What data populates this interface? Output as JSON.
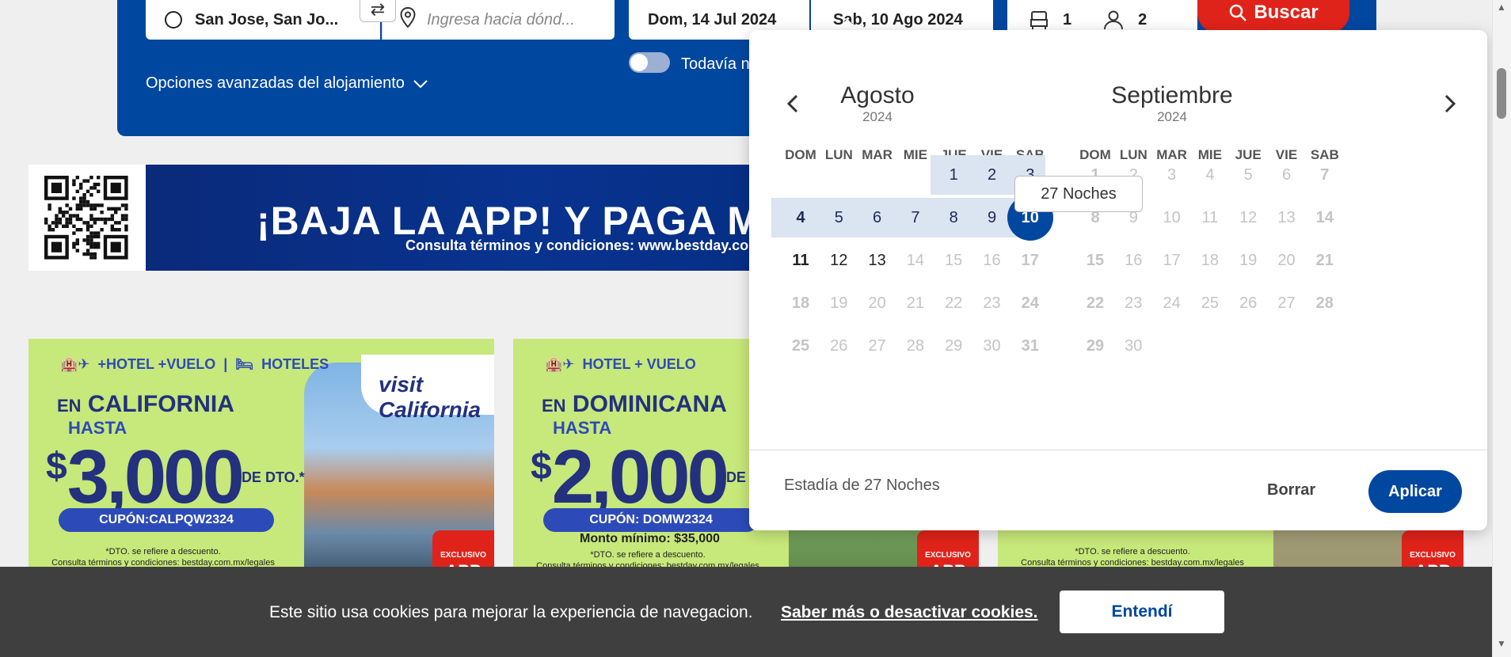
{
  "search": {
    "origin": "San Jose, San Jo...",
    "destination_placeholder": "Ingresa hacia dónd...",
    "checkin": "Dom, 14 Jul 2024",
    "checkout": "Sab, 10 Ago 2024",
    "rooms": "1",
    "adults": "2",
    "search_label": "Buscar",
    "advanced_options": "Opciones avanzadas del alojamiento",
    "toggle_label": "Todavía n"
  },
  "banner": {
    "headline": "¡BAJA LA APP! Y PAGA ME",
    "terms": "Consulta términos y condiciones: www.bestday.com"
  },
  "cards": [
    {
      "header": "HOTEL + VUELO | HOTELES",
      "header_a": "+HOTEL +VUELO",
      "header_b": "HOTELES",
      "prefix": "EN",
      "destination": "CALIFORNIA",
      "upto": "HASTA",
      "currency": "$",
      "amount": "3,000",
      "suffix": "DE DTO.*",
      "coupon": "CUPÓN:CALPQW2324",
      "minimum": "",
      "fine1": "*DTO. se refiere a descuento.",
      "fine2": "Consulta términos y condiciones: bestday.com.mx/legales",
      "logo": "visit California",
      "exclusive": "EXCLUSIVO",
      "app": "APP"
    },
    {
      "header_a": "HOTEL + VUELO",
      "header_b": "",
      "prefix": "EN",
      "destination": "DOMINICANA",
      "upto": "HASTA",
      "currency": "$",
      "amount": "2,000",
      "suffix": "DE DTO.",
      "coupon": "CUPÓN: DOMW2324",
      "minimum": "Monto mínimo: $35,000",
      "fine1": "*DTO. se refiere a descuento.",
      "fine2": "Consulta términos y condiciones: bestday.com.mx/legales",
      "exclusive": "EXCLUSIVO",
      "app": "APP"
    },
    {
      "fine1": "*DTO. se refiere a descuento.",
      "fine2": "Consulta términos y condiciones: bestday.com.mx/legales",
      "exclusive": "EXCLUSIVO",
      "app": "APP"
    }
  ],
  "datepicker": {
    "weekdays": [
      "DOM",
      "LUN",
      "MAR",
      "MIE",
      "JUE",
      "VIE",
      "SAB"
    ],
    "months": [
      {
        "name": "Agosto",
        "year": "2024",
        "first_weekday": 4,
        "days": 31
      },
      {
        "name": "Septiembre",
        "year": "2024",
        "first_weekday": 0,
        "days": 30
      }
    ],
    "selected_end": {
      "month": 0,
      "day": 10
    },
    "range_days_in_view": [
      1,
      2,
      3,
      4,
      5,
      6,
      7,
      8,
      9,
      10
    ],
    "enabled_until": {
      "month": 0,
      "day": 13
    },
    "tooltip": "27 Noches",
    "stay_label": "Estadía de 27 Noches",
    "clear_label": "Borrar",
    "apply_label": "Aplicar",
    "colors": {
      "accent": "#0047a0",
      "range": "#dbe4f1",
      "disabled": "#c4c4c4"
    }
  },
  "cookies": {
    "text": "Este sitio usa cookies para mejorar la experiencia de navegacion.",
    "link": "Saber más o desactivar cookies.",
    "accept": "Entendí"
  },
  "colors": {
    "primary": "#0047a0",
    "search_button": "#e0231a",
    "promo_green": "#c7e87a"
  }
}
